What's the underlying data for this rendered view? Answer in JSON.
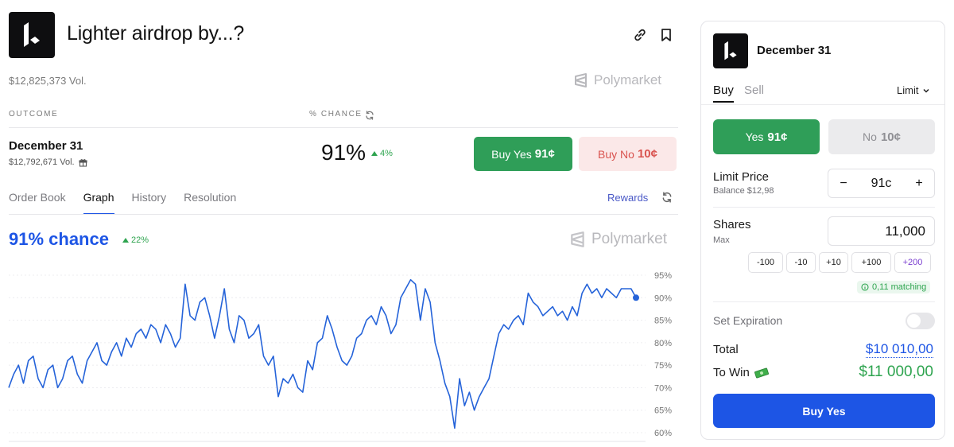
{
  "header": {
    "title": "Lighter airdrop by...?",
    "volume": "$12,825,373 Vol.",
    "brand": "Polymarket",
    "link_icon": "link-icon",
    "bookmark_icon": "bookmark-icon"
  },
  "outcomes_table": {
    "col_outcome": "OUTCOME",
    "col_chance": "% CHANCE",
    "row": {
      "name": "December 31",
      "volume": "$12,792,671 Vol.",
      "chance": "91%",
      "delta": "4%",
      "buy_yes_label": "Buy Yes",
      "buy_yes_price": "91¢",
      "buy_no_label": "Buy No",
      "buy_no_price": "10¢"
    }
  },
  "tabs": {
    "items": [
      "Order Book",
      "Graph",
      "History",
      "Resolution"
    ],
    "active": "Graph",
    "rewards": "Rewards"
  },
  "graph": {
    "chance_label": "91% chance",
    "delta": "22%",
    "brand": "Polymarket"
  },
  "chart_data": {
    "type": "line",
    "title": "",
    "xlabel": "",
    "ylabel": "",
    "ylim": [
      60,
      97
    ],
    "yticks": [
      "95%",
      "90%",
      "85%",
      "80%",
      "75%",
      "70%",
      "65%",
      "60%"
    ],
    "grid": true,
    "series": [
      {
        "color": "#2563d9",
        "values": [
          70,
          73,
          75,
          71,
          76,
          77,
          72,
          70,
          74,
          75,
          70,
          72,
          76,
          77,
          73,
          71,
          76,
          78,
          80,
          76,
          75,
          78,
          80,
          77,
          81,
          79,
          82,
          83,
          81,
          84,
          83,
          80,
          84,
          82,
          79,
          81,
          93,
          86,
          85,
          89,
          90,
          86,
          81,
          86,
          92,
          83,
          80,
          86,
          85,
          81,
          82,
          84,
          77,
          75,
          77,
          68,
          72,
          71,
          73,
          70,
          69,
          76,
          74,
          80,
          81,
          86,
          83,
          79,
          76,
          75,
          77,
          81,
          82,
          85,
          86,
          84,
          88,
          86,
          82,
          84,
          90,
          92,
          94,
          93,
          85,
          92,
          89,
          80,
          76,
          71,
          68,
          61,
          72,
          66,
          69,
          65,
          68,
          70,
          72,
          77,
          82,
          84,
          83,
          85,
          86,
          84,
          91,
          89,
          88,
          86,
          87,
          88,
          86,
          87,
          85,
          88,
          86,
          91,
          93,
          91,
          92,
          90,
          92,
          91,
          90,
          92,
          92,
          92,
          90
        ]
      }
    ]
  },
  "order_panel": {
    "title": "December 31",
    "tab_buy": "Buy",
    "tab_sell": "Sell",
    "order_type": "Limit",
    "yes_label": "Yes",
    "yes_price": "91¢",
    "no_label": "No",
    "no_price": "10¢",
    "limit_price_label": "Limit Price",
    "balance": "Balance $12,98",
    "stepper_minus": "−",
    "stepper_value": "91c",
    "stepper_plus": "+",
    "shares_label": "Shares",
    "shares_sub": "Max",
    "shares_value": "11,000",
    "quick_amounts": [
      "-100",
      "-10",
      "+10",
      "+100",
      "+200"
    ],
    "matching": "0,11 matching",
    "expiration_label": "Set Expiration",
    "expiration_on": false,
    "total_label": "Total",
    "total_value": "$10 010,00",
    "win_label": "To Win",
    "win_value": "$11 000,00",
    "buy_button": "Buy Yes"
  },
  "colors": {
    "accent_blue": "#1d55e5",
    "green": "#2f9e58",
    "red": "#d9534f"
  }
}
